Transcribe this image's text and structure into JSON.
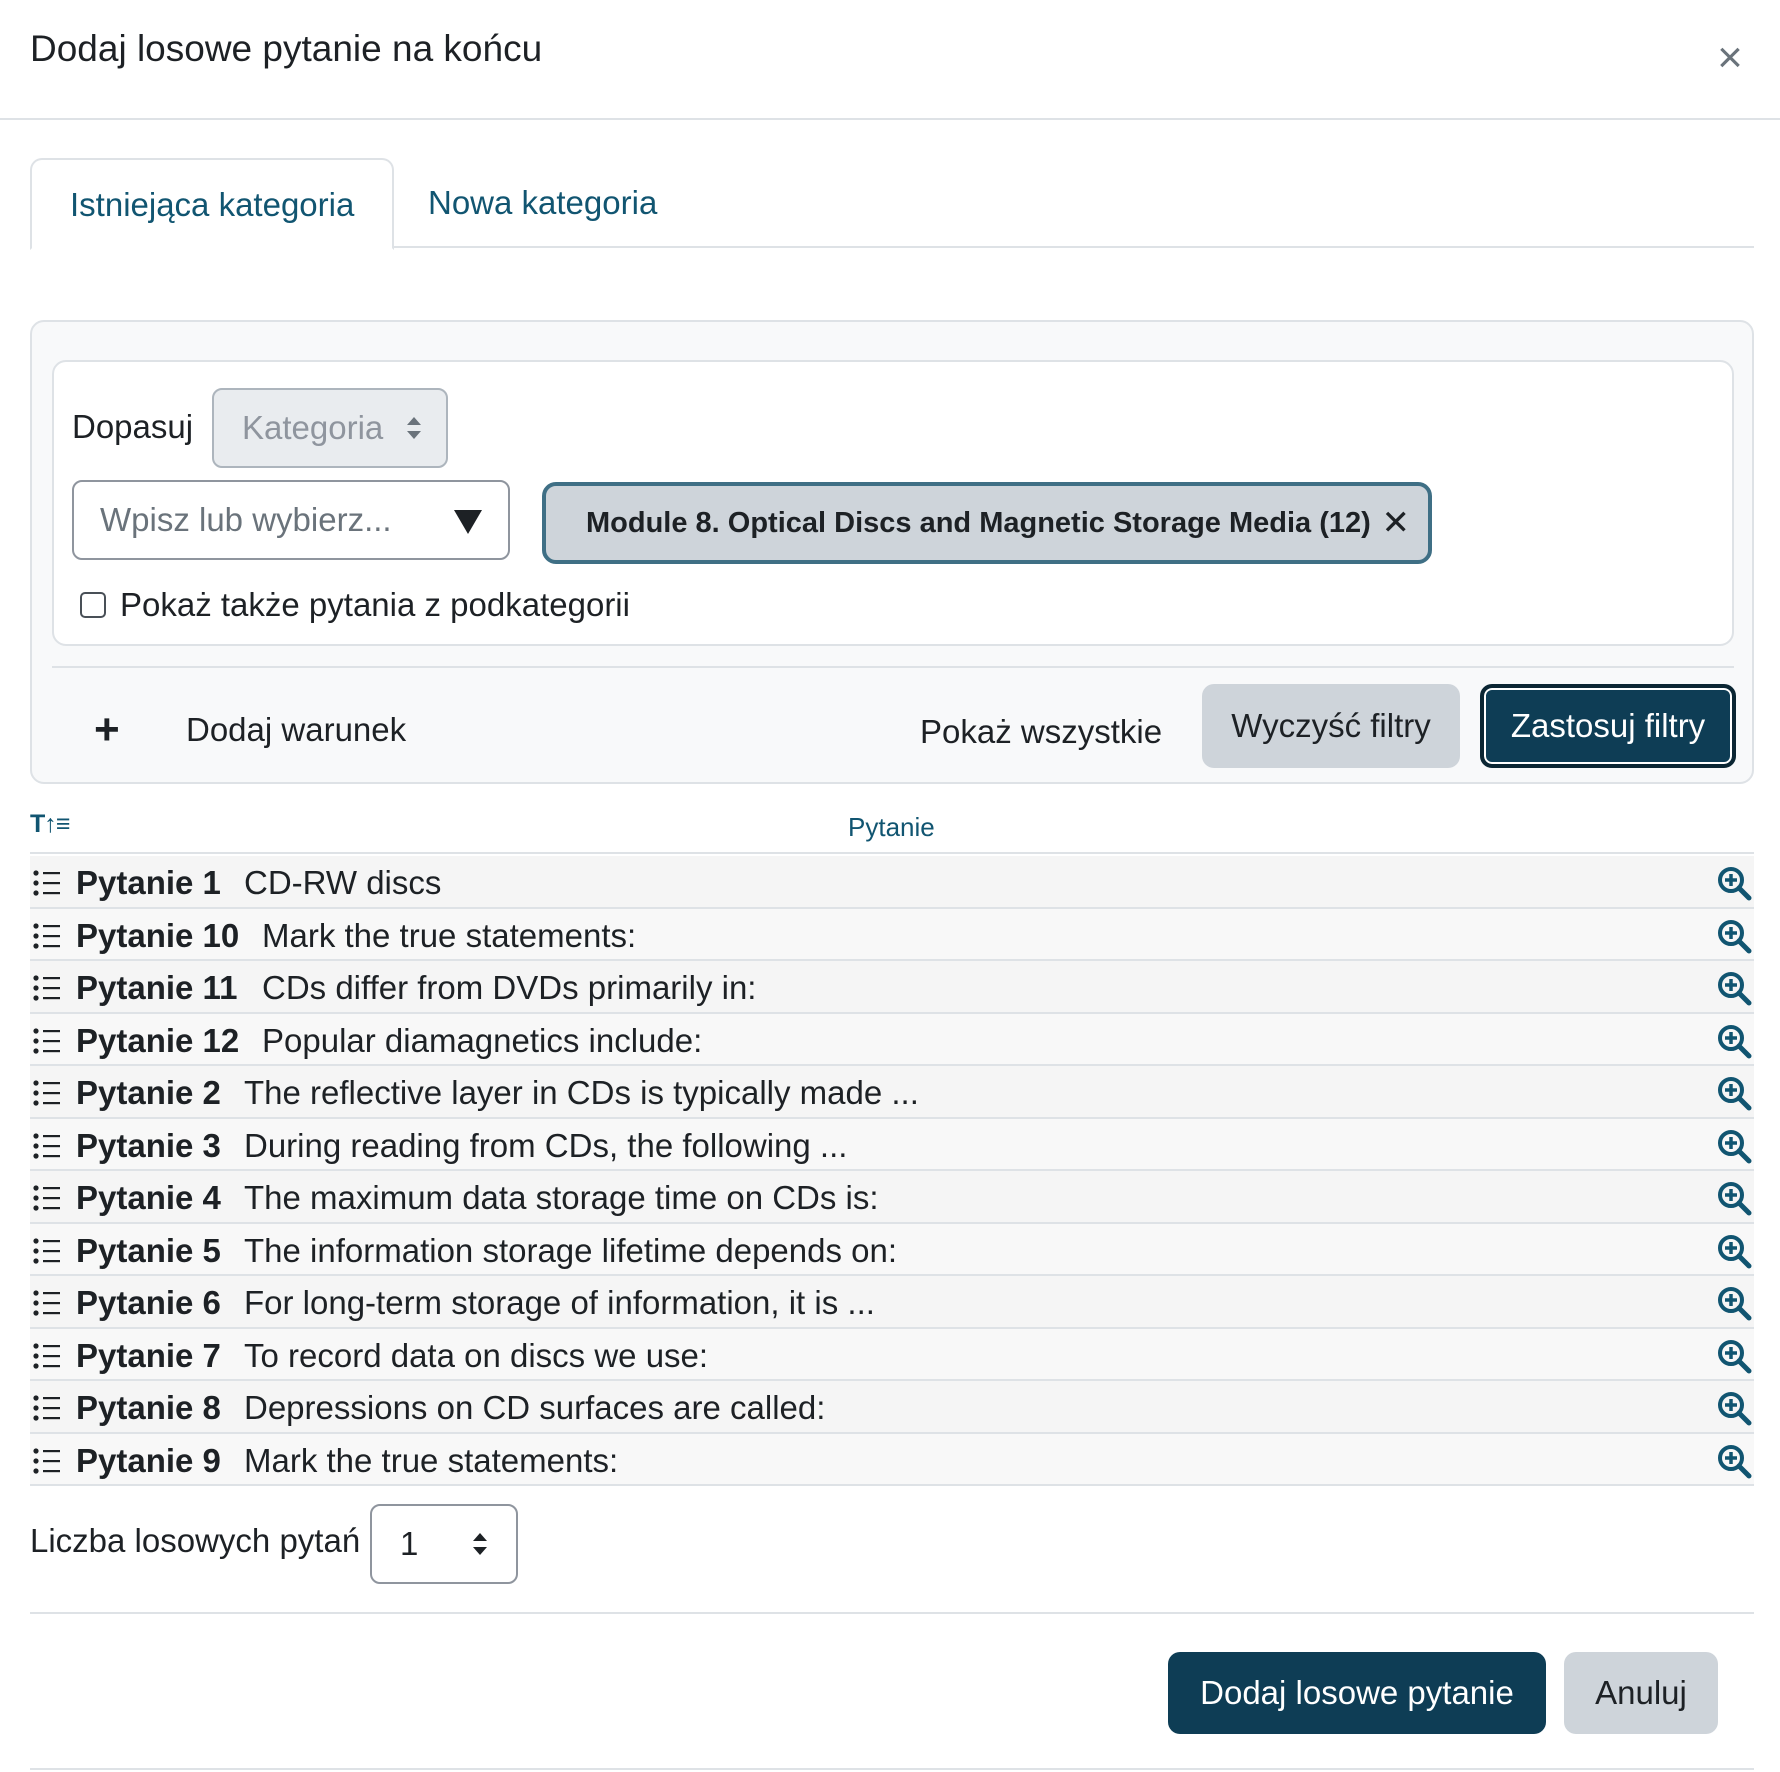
{
  "dialog": {
    "title": "Dodaj losowe pytanie na końcu",
    "close_symbol": "×"
  },
  "tabs": [
    {
      "label": "Istniejąca kategoria",
      "active": true
    },
    {
      "label": "Nowa kategoria",
      "active": false
    }
  ],
  "filter": {
    "match_label": "Dopasuj",
    "match_select": "Kategoria",
    "type_placeholder": "Wpisz lub wybierz...",
    "selected_category": "Module 8. Optical Discs and Magnetic Storage Media (12)",
    "chip_remove": "✕",
    "subcategories_label": "Pokaż także pytania z podkategorii",
    "add_condition_label": "Dodaj warunek",
    "add_symbol": "+",
    "show_all": "Pokaż wszystkie",
    "clear_button": "Wyczyść filtry",
    "apply_button": "Zastosuj filtry"
  },
  "table": {
    "sort_icon_label": "T↑≡",
    "column_header": "Pytanie",
    "rows": [
      {
        "name": "Pytanie 1",
        "text": "CD-RW discs"
      },
      {
        "name": "Pytanie 10",
        "text": "Mark the true statements:"
      },
      {
        "name": "Pytanie 11",
        "text": "CDs differ from DVDs primarily in:"
      },
      {
        "name": "Pytanie 12",
        "text": "Popular diamagnetics include:"
      },
      {
        "name": "Pytanie 2",
        "text": "The reflective layer in CDs is typically made ..."
      },
      {
        "name": "Pytanie 3",
        "text": "During reading from CDs, the following ..."
      },
      {
        "name": "Pytanie 4",
        "text": "The maximum data storage time on CDs is:"
      },
      {
        "name": "Pytanie 5",
        "text": "The information storage lifetime depends on:"
      },
      {
        "name": "Pytanie 6",
        "text": "For long-term storage of information, it is ..."
      },
      {
        "name": "Pytanie 7",
        "text": "To record data on discs we use:"
      },
      {
        "name": "Pytanie 8",
        "text": "Depressions on CD surfaces are called:"
      },
      {
        "name": "Pytanie 9",
        "text": "Mark the true statements:"
      }
    ]
  },
  "count": {
    "label": "Liczba losowych pytań",
    "value": "1"
  },
  "footer": {
    "add_button": "Dodaj losowe pytanie",
    "cancel_button": "Anuluj"
  },
  "colors": {
    "primary": "#0e3d55",
    "link": "#115571",
    "secondary": "#ced4da",
    "chip_border": "#3f6f85"
  },
  "icons": {
    "row": "list-icon",
    "preview": "zoom-in-icon",
    "sort": "sort-icon",
    "close": "close-icon"
  }
}
